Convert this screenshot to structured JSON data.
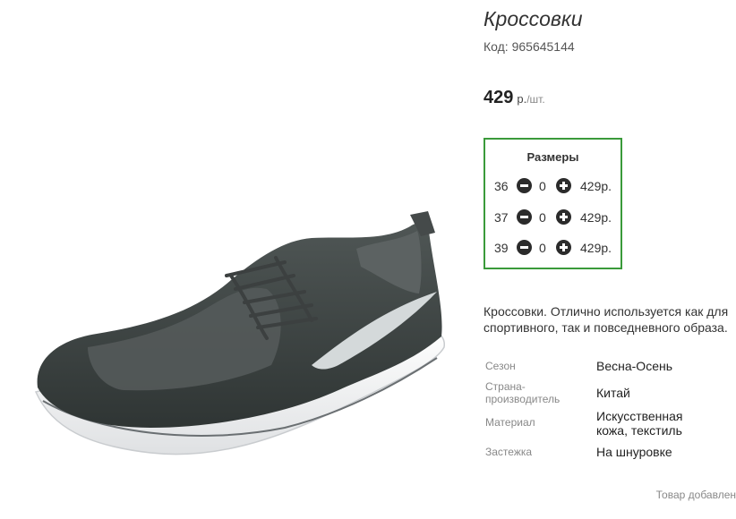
{
  "product": {
    "title": "Кроссовки",
    "sku_label": "Код:",
    "sku": "965645144",
    "price": "429",
    "currency": "р.",
    "unit": "/шт.",
    "image_icon": "sneaker-image"
  },
  "sizes": {
    "title": "Размеры",
    "rows": [
      {
        "size": "36",
        "qty": "0",
        "price": "429р."
      },
      {
        "size": "37",
        "qty": "0",
        "price": "429р."
      },
      {
        "size": "39",
        "qty": "0",
        "price": "429р."
      }
    ],
    "icons": {
      "minus": "minus-circle-icon",
      "plus": "plus-circle-icon"
    },
    "border_color": "#3a9a3a"
  },
  "description": "Кроссовки. Отлично используется как для спортивного, так и повседневного образа.",
  "specs": [
    {
      "label": "Сезон",
      "value": "Весна-Осень"
    },
    {
      "label": "Страна-производитель",
      "value": "Китай"
    },
    {
      "label": "Материал",
      "value": "Искусственная кожа, текстиль"
    },
    {
      "label": "Застежка",
      "value": "На шнуровке"
    }
  ],
  "notice": "Товар добавлен"
}
